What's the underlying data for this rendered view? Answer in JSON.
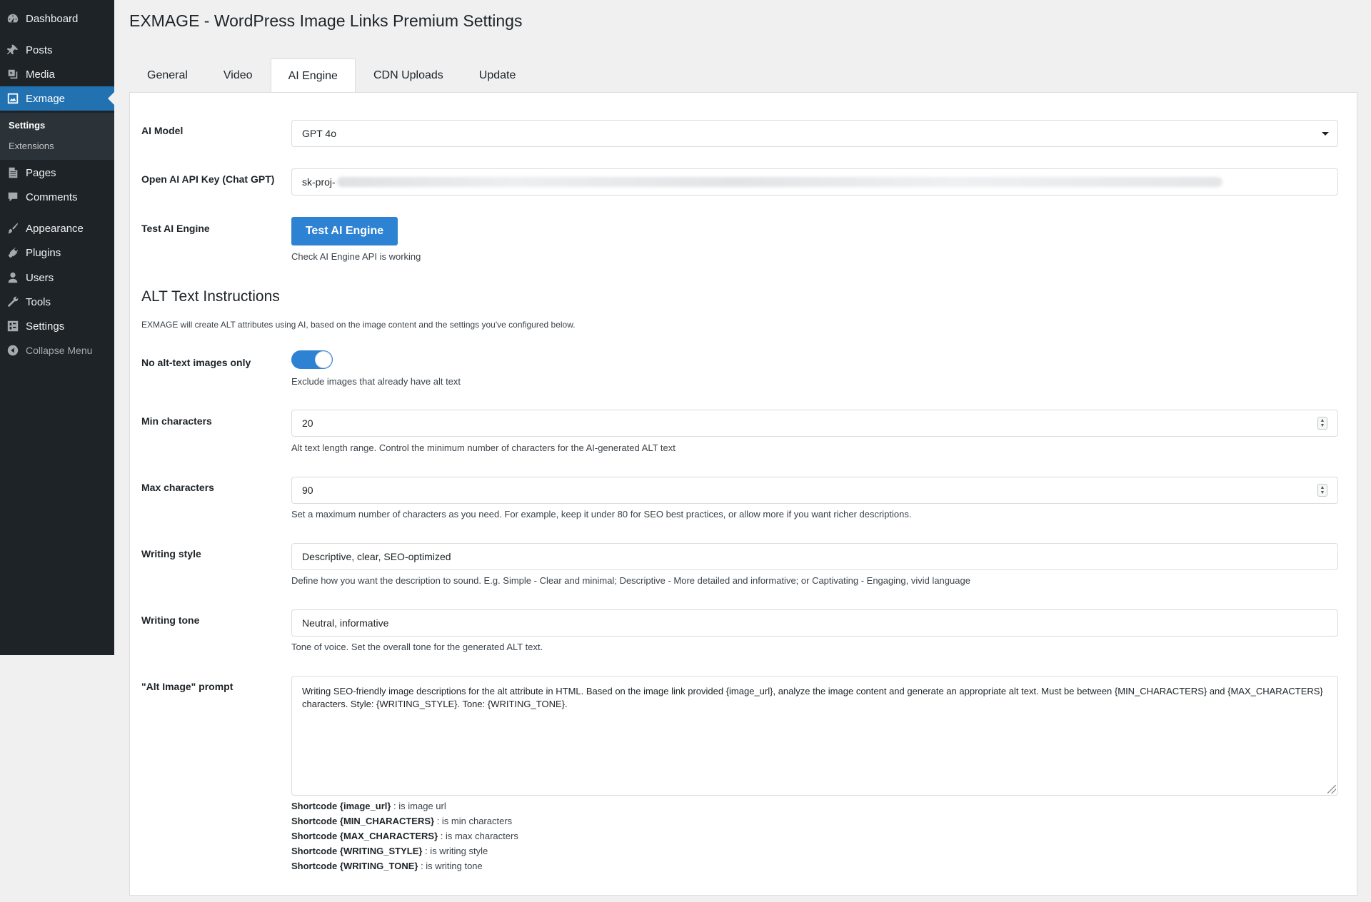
{
  "sidebar": {
    "items": [
      {
        "label": "Dashboard",
        "icon": "dashboard-icon"
      },
      {
        "label": "Posts",
        "icon": "pin-icon"
      },
      {
        "label": "Media",
        "icon": "media-icon"
      },
      {
        "label": "Exmage",
        "icon": "exmage-icon"
      },
      {
        "label": "Pages",
        "icon": "pages-icon"
      },
      {
        "label": "Comments",
        "icon": "comments-icon"
      },
      {
        "label": "Appearance",
        "icon": "brush-icon"
      },
      {
        "label": "Plugins",
        "icon": "plug-icon"
      },
      {
        "label": "Users",
        "icon": "user-icon"
      },
      {
        "label": "Tools",
        "icon": "wrench-icon"
      },
      {
        "label": "Settings",
        "icon": "settings-icon"
      },
      {
        "label": "Collapse Menu",
        "icon": "collapse-icon"
      }
    ],
    "submenu": [
      {
        "label": "Settings"
      },
      {
        "label": "Extensions"
      }
    ]
  },
  "page": {
    "title": "EXMAGE - WordPress Image Links Premium Settings"
  },
  "tabs": [
    {
      "label": "General"
    },
    {
      "label": "Video"
    },
    {
      "label": "AI Engine"
    },
    {
      "label": "CDN Uploads"
    },
    {
      "label": "Update"
    }
  ],
  "form": {
    "ai_model": {
      "label": "AI Model",
      "value": "GPT 4o"
    },
    "api_key": {
      "label": "Open AI API Key (Chat GPT)",
      "value_prefix": "sk-proj-"
    },
    "test_engine": {
      "label": "Test AI Engine",
      "button": "Test AI Engine",
      "help": "Check AI Engine API is working"
    },
    "alt_section": {
      "title": "ALT Text Instructions",
      "description": "EXMAGE will create ALT attributes using AI, based on the image content and the settings you've configured below."
    },
    "no_alt_only": {
      "label": "No alt-text images only",
      "checked": true,
      "help": "Exclude images that already have alt text"
    },
    "min_chars": {
      "label": "Min characters",
      "value": "20",
      "help": "Alt text length range. Control the minimum number of characters for the AI-generated ALT text"
    },
    "max_chars": {
      "label": "Max characters",
      "value": "90",
      "help": "Set a maximum number of characters as you need. For example, keep it under 80 for SEO best practices, or allow more if you want richer descriptions."
    },
    "writing_style": {
      "label": "Writing style",
      "value": "Descriptive, clear, SEO-optimized",
      "help": "Define how you want the description to sound. E.g. Simple - Clear and minimal; Descriptive - More detailed and informative; or Captivating - Engaging, vivid language"
    },
    "writing_tone": {
      "label": "Writing tone",
      "value": "Neutral, informative",
      "help": "Tone of voice. Set the overall tone for the generated ALT text."
    },
    "alt_prompt": {
      "label": "\"Alt Image\" prompt",
      "value": "Writing SEO-friendly image descriptions for the alt attribute in HTML. Based on the image link provided {image_url}, analyze the image content and generate an appropriate alt text. Must be between {MIN_CHARACTERS} and {MAX_CHARACTERS} characters. Style: {WRITING_STYLE}. Tone: {WRITING_TONE}."
    },
    "shortcodes": [
      {
        "code": "Shortcode {image_url}",
        "desc": " : is image url"
      },
      {
        "code": "Shortcode {MIN_CHARACTERS}",
        "desc": " : is min characters"
      },
      {
        "code": "Shortcode {MAX_CHARACTERS}",
        "desc": " : is max characters"
      },
      {
        "code": "Shortcode {WRITING_STYLE}",
        "desc": " : is writing style"
      },
      {
        "code": "Shortcode {WRITING_TONE}",
        "desc": " : is writing tone"
      }
    ]
  },
  "colors": {
    "sidebar_bg": "#1d2327",
    "accent": "#2271b1",
    "button": "#2e82d4",
    "page_bg": "#f0f0f1"
  }
}
